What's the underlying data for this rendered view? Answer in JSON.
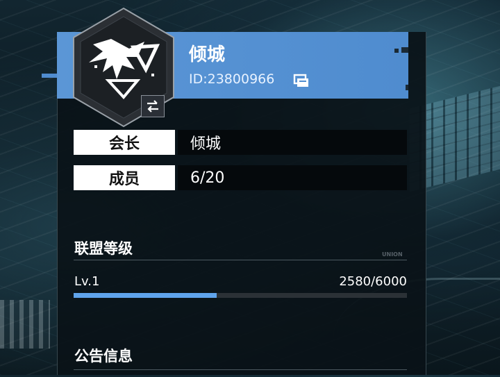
{
  "guild": {
    "name": "倾城",
    "id_text": "ID:23800966"
  },
  "info": {
    "leader_label": "会长",
    "leader_value": "倾城",
    "members_label": "成员",
    "members_value": "6/20"
  },
  "level_section": {
    "title": "联盟等级",
    "tag": "UNION",
    "level": "Lv.1",
    "exp_text": "2580/6000",
    "progress_fraction": 0.43
  },
  "notice_section": {
    "title": "公告信息"
  },
  "colors": {
    "header": "#4f8ccf",
    "progress": "#5fa4ec"
  },
  "icons": {
    "emblem": "eagle-emblem-icon",
    "swap": "swap-arrows-icon",
    "copy": "copy-icon"
  }
}
